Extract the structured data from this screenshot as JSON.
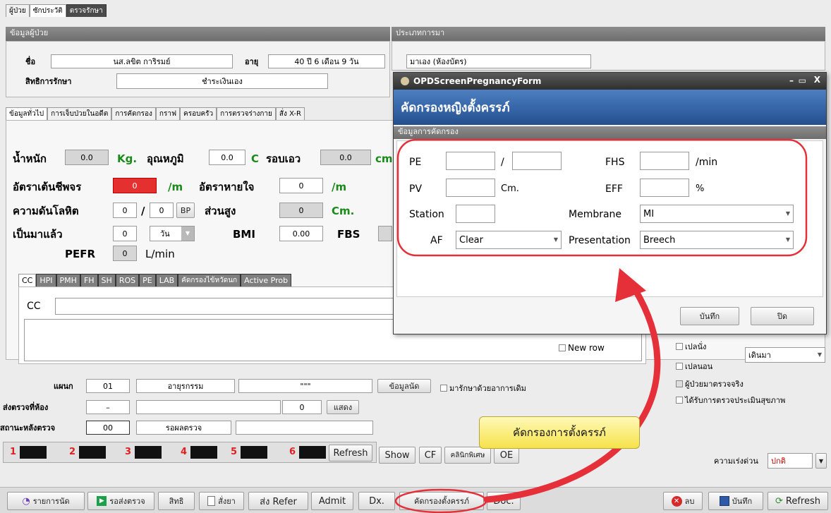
{
  "top_tabs": [
    "ผู้ป่วย",
    "ซักประวัติ",
    "ตรวจรักษา"
  ],
  "patient_section": {
    "title": "ข้อมูลผู้ป่วย",
    "name_label": "ชื่อ",
    "name_value": "นส.ลขิต การิรมย์",
    "age_label": "อายุ",
    "age_value": "40 ปี 6 เดือน 9 วัน",
    "right_label": "สิทธิการรักษา",
    "right_value": "ชำระเงินเอง"
  },
  "visit_type": {
    "title": "ประเภทการมา",
    "value": "มาเอง (ห้องบัตร)"
  },
  "main_tabs": [
    "ข้อมูลทั่วไป",
    "การเจ็บป่วยในอดีต",
    "การคัดกรอง",
    "กราฟ",
    "ครอบครัว",
    "การตรวจร่างกาย",
    "สั่ง X-R"
  ],
  "vitals": {
    "weight_label": "น้ำหนัก",
    "weight_value": "0.0",
    "weight_unit": "Kg.",
    "temp_label": "อุณหภูมิ",
    "temp_value": "0.0",
    "temp_unit": "C",
    "waist_label": "รอบเอว",
    "waist_value": "0.0",
    "waist_unit": "cm",
    "pulse_label": "อัตราเต้นชีพจร",
    "pulse_value": "0",
    "pulse_unit": "/m",
    "resp_label": "อัตราหายใจ",
    "resp_value": "0",
    "resp_unit": "/m",
    "bp_label": "ความดันโลหิต",
    "bp_sys": "0",
    "bp_slash": "/",
    "bp_dia": "0",
    "bp_btn": "BP",
    "height_label": "ส่วนสูง",
    "height_value": "0",
    "height_unit": "Cm.",
    "duration_label": "เป็นมาแล้ว",
    "duration_value": "0",
    "duration_unit": "วัน",
    "bmi_label": "BMI",
    "bmi_value": "0.00",
    "fbs_label": "FBS",
    "pefr_label": "PEFR",
    "pefr_value": "0",
    "pefr_unit": "L/min"
  },
  "cc_tabs": [
    "CC",
    "HPI",
    "PMH",
    "FH",
    "SH",
    "ROS",
    "PE",
    "LAB",
    "คัดกรองไข้หวัดนก",
    "Active Prob"
  ],
  "cc_label": "CC",
  "new_row_label": "New row",
  "dept": {
    "label": "แผนก",
    "code": "01",
    "name": "อายุรกรรม",
    "extra": "\"\"\"",
    "appt_btn": "ข้อมูลนัด",
    "old_symptom_label": "มารักษาด้วยอาการเดิม"
  },
  "send_room": {
    "label": "ส่งตรวจที่ห้อง",
    "code": "–",
    "count": "0",
    "show_btn": "แสดง"
  },
  "status_after": {
    "label": "สถานะหลังตรวจ",
    "code": "00",
    "name": "รอผลตรวจ"
  },
  "queue": {
    "numbers": [
      "1",
      "2",
      "3",
      "4",
      "5",
      "6"
    ],
    "refresh": "Refresh",
    "show": "Show",
    "cf": "CF",
    "clinic": "คลินิกพิเศษ",
    "oe": "OE"
  },
  "right_options": {
    "items": [
      "เปลนั่ง",
      "เปลนอน",
      "ผู้ป่วยมาตรวจจริง",
      "ได้รับการตรวจประเมินสุขภาพ"
    ],
    "walk_value": "เดินมา",
    "urgency_label": "ความเร่งด่วน",
    "urgency_value": "ปกติ"
  },
  "bottom_bar": {
    "appointments": "รายการนัด",
    "wait_exam": "รอส่งตรวจ",
    "rights": "สิทธิ",
    "order_drug": "สั่งยา",
    "refer": "ส่ง Refer",
    "admit": "Admit",
    "dx": "Dx.",
    "preg_screen": "คัดกรองตั้งครรภ์",
    "doc": "Doc.",
    "delete": "ลบ",
    "save": "บันทึก",
    "refresh": "Refresh"
  },
  "callout": "คัดกรองการตั้งครรภ์",
  "dialog": {
    "window_title": "OPDScreenPregnancyForm",
    "heading": "คัดกรองหญิงตั้งครรภ์",
    "section": "ข้อมูลการคัดกรอง",
    "pe_label": "PE",
    "pe_slash": "/",
    "fhs_label": "FHS",
    "fhs_unit": "/min",
    "pv_label": "PV",
    "pv_unit": "Cm.",
    "eff_label": "EFF",
    "eff_unit": "%",
    "station_label": "Station",
    "membrane_label": "Membrane",
    "membrane_value": "MI",
    "af_label": "AF",
    "af_value": "Clear",
    "presentation_label": "Presentation",
    "presentation_value": "Breech",
    "save_btn": "บันทึก",
    "close_btn": "ปิด"
  }
}
